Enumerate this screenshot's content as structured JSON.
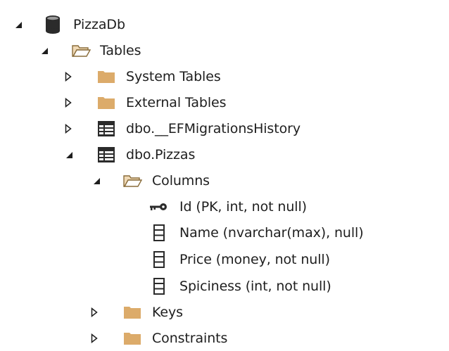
{
  "tree": {
    "db": {
      "label": "PizzaDb",
      "expanded": true,
      "icon": "database-icon"
    },
    "tables": {
      "label": "Tables",
      "expanded": true,
      "icon": "folder-open-icon"
    },
    "system_tables": {
      "label": "System Tables",
      "expanded": false,
      "icon": "folder-icon"
    },
    "external_tables": {
      "label": "External Tables",
      "expanded": false,
      "icon": "folder-icon"
    },
    "ef_history": {
      "label": "dbo.__EFMigrationsHistory",
      "expanded": false,
      "icon": "table-icon"
    },
    "pizzas": {
      "label": "dbo.Pizzas",
      "expanded": true,
      "icon": "table-icon"
    },
    "columns": {
      "label": "Columns",
      "expanded": true,
      "icon": "folder-open-icon"
    },
    "col_id": {
      "label": "Id (PK, int, not null)",
      "icon": "key-icon"
    },
    "col_name": {
      "label": "Name (nvarchar(max), null)",
      "icon": "column-icon"
    },
    "col_price": {
      "label": "Price (money, not null)",
      "icon": "column-icon"
    },
    "col_spiciness": {
      "label": "Spiciness (int, not null)",
      "icon": "column-icon"
    },
    "keys": {
      "label": "Keys",
      "expanded": false,
      "icon": "folder-icon"
    },
    "constraints": {
      "label": "Constraints",
      "expanded": false,
      "icon": "folder-icon"
    }
  },
  "colors": {
    "folder": "#dcab6a",
    "folder_open_stroke": "#8a6d3b",
    "icon_dark": "#2b2b2b",
    "text": "#1e1e1e"
  }
}
